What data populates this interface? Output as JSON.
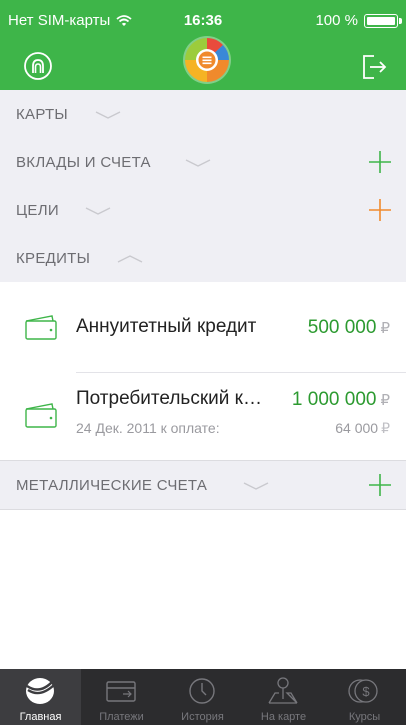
{
  "status_bar": {
    "carrier": "Нет SIM-карты",
    "time": "16:36",
    "battery": "100 %"
  },
  "header": {
    "left_icon": "sberbank-profile-icon",
    "center_icon": "pie-chart-menu-icon",
    "right_icon": "logout-icon"
  },
  "sections": {
    "cards": {
      "label": "КАРТЫ"
    },
    "deposits": {
      "label": "ВКЛАДЫ И СЧЕТА"
    },
    "goals": {
      "label": "ЦЕЛИ"
    },
    "credits": {
      "label": "КРЕДИТЫ"
    },
    "metal": {
      "label": "МЕТАЛЛИЧЕСКИЕ СЧЕТА"
    }
  },
  "credits": [
    {
      "name": "Аннуитетный кредит",
      "amount": "500 000",
      "currency": "₽"
    },
    {
      "name": "Потребительский к…",
      "amount": "1 000 000",
      "currency": "₽",
      "due_text": "24 Дек. 2011 к оплате:",
      "due_amount": "64 000",
      "due_currency": "₽"
    }
  ],
  "tabs": [
    {
      "label": "Главная",
      "icon": "sberbank-logo-icon"
    },
    {
      "label": "Платежи",
      "icon": "card-icon"
    },
    {
      "label": "История",
      "icon": "clock-icon"
    },
    {
      "label": "На карте",
      "icon": "map-pin-icon"
    },
    {
      "label": "Курсы",
      "icon": "currency-icon"
    }
  ],
  "colors": {
    "header_green": "#3eb549",
    "amount_green": "#2c9a30",
    "plus_green": "#3eb549",
    "plus_orange": "#f08a2c",
    "tabbar": "#2c2c2e"
  }
}
